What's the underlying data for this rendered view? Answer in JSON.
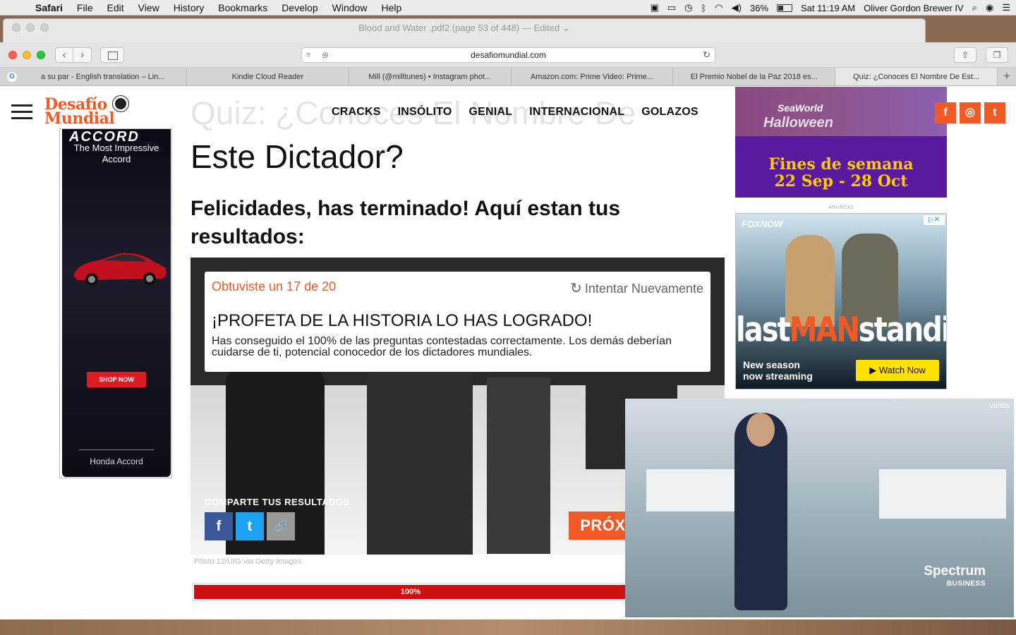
{
  "menubar": {
    "apple": "",
    "items": [
      "Safari",
      "File",
      "Edit",
      "View",
      "History",
      "Bookmarks",
      "Develop",
      "Window",
      "Help"
    ],
    "battery": "36%",
    "clock": "Sat 11:19 AM",
    "user": "Oliver Gordon Brewer IV"
  },
  "preview_window": {
    "title": "Blood and Water .pdf2 (page 53 of 448)",
    "edited": "— Edited"
  },
  "safari": {
    "url": "desafiomundial.com",
    "tabs": [
      "a su par - English translation – Lin...",
      "Kindle Cloud Reader",
      "Mill (@milltunes) • Instagram phot...",
      "Amazon.com: Prime Video: Prime...",
      "El Premio Nobel de la Paz 2018 es...",
      "Quiz: ¿Conoces El Nombre De Est..."
    ]
  },
  "site": {
    "logo_line1": "Desafío",
    "logo_line2": "Mundial",
    "nav": [
      "CRACKS",
      "INSÓLITO",
      "GENIAL",
      "INTERNACIONAL",
      "GOLAZOS"
    ],
    "social": {
      "facebook": "f",
      "instagram": "◎",
      "twitter": "t"
    }
  },
  "article": {
    "title_faded": "Quiz: ¿Conoces El Nombre De",
    "title_line2": "Este Dictador?",
    "subtitle": "Felicidades, has terminado! Aquí estan tus resultados:",
    "score": "Obtuviste un 17 de 20",
    "retry": "Intentar Nuevamente",
    "result_heading": "¡PROFETA DE LA HISTORIA LO HAS LOGRADO!",
    "result_text": "Has conseguido el 100% de las preguntas contestadas correctamente. Los demás deberían cuidarse de ti, potencial conocedor de los dictadores mundiales.",
    "share_label": "COMPARTE TUS RESULTADOS",
    "next_quiz": "PRÓXIMO QUIZ",
    "photo_credit": "Photo 12/UIG via Getty Images.",
    "progress_label": "100%",
    "progress_value": 1.0
  },
  "ads": {
    "honda": {
      "brand": "ACCORD",
      "tagline": "The Most Impressive Accord",
      "cta": "SHOP NOW",
      "model": "Honda Accord"
    },
    "seaworld": {
      "brand": "SeaWorld",
      "event": "Halloween",
      "line1": "Fines de semana",
      "line2": "22 Sep - 28 Oct"
    },
    "anuncio": "ANUNCIO",
    "fox": {
      "brand": "FOXNOW",
      "show_pre": "last",
      "show_man": "MAN",
      "show_post": "standing",
      "tag1": "New season",
      "tag2": "now streaming",
      "cta": "Watch Now"
    },
    "video": {
      "source": "vantis",
      "brand": "Spectrum",
      "brand_sub": "BUSINESS"
    }
  }
}
